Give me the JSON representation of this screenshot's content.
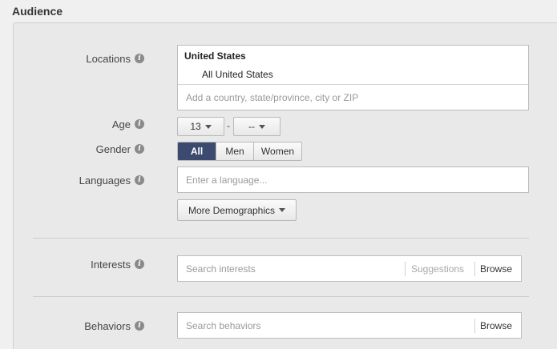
{
  "section_title": "Audience",
  "locations": {
    "label": "Locations",
    "country": "United States",
    "scope": "All United States",
    "placeholder": "Add a country, state/province, city or ZIP"
  },
  "age": {
    "label": "Age",
    "min": "13",
    "separator": "-",
    "max": "--"
  },
  "gender": {
    "label": "Gender",
    "options": [
      "All",
      "Men",
      "Women"
    ],
    "selected": "All"
  },
  "languages": {
    "label": "Languages",
    "placeholder": "Enter a language..."
  },
  "more_demographics": "More Demographics",
  "interests": {
    "label": "Interests",
    "placeholder": "Search interests",
    "suggestions": "Suggestions",
    "browse": "Browse"
  },
  "behaviors": {
    "label": "Behaviors",
    "placeholder": "Search behaviors",
    "browse": "Browse"
  },
  "icons": {
    "info": "info-icon",
    "dropdown": "caret-down-icon"
  },
  "colors": {
    "active_segment": "#3b4a6e",
    "panel_bg": "#e9e9e9"
  }
}
